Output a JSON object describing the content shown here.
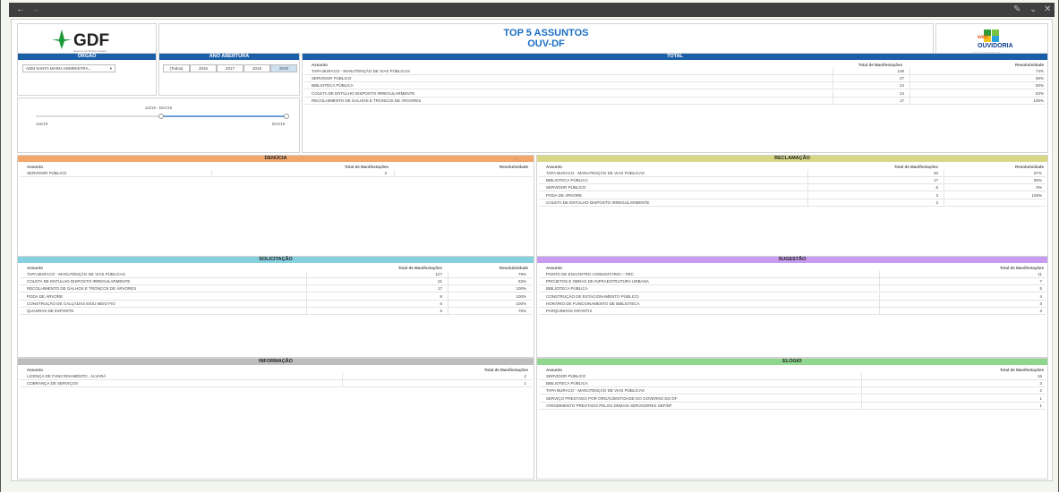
{
  "header": {
    "logo_left": "GDF",
    "logo_left_sub": "Governo do Distrito Federal",
    "title_line1": "TOP 5 ASSUNTOS",
    "title_line2": "OUV-DF",
    "logo_right": "OUVIDORIA",
    "logo_right_url": "www.ouvidoria.df.gov.br"
  },
  "filters": {
    "orgao_header": "ÓRGÃO",
    "orgao_value": "ADM SANTA MARIA ADMINISTRA...",
    "ano_header": "ANO ABERTURA",
    "ano_options": [
      "(Todos)",
      "2016",
      "2017",
      "2018",
      "2019"
    ],
    "ano_selected": "2019",
    "range_label": "Jul/19 - Dec/19",
    "range_min": "Jan/19",
    "range_max": "Dec/19",
    "range_fraction": [
      0.5,
      1.0
    ]
  },
  "colors": {
    "blue": "#1a5fa8",
    "denuncia": "#f3a66a",
    "reclamacao": "#d7d785",
    "solicitacao": "#86d1e0",
    "sugestao": "#c89bf0",
    "informacao": "#bdbdbd",
    "elogio": "#8fd68f"
  },
  "cols": {
    "assunto": "Assunto",
    "total": "Total de Manifestações",
    "resol": "Resolutividade"
  },
  "total": {
    "title": "TOTAL",
    "rows": [
      [
        "TAPA BURACO - MANUTENÇÃO DE VIAS PÚBLICAS",
        "149",
        "74%"
      ],
      [
        "SERVIDOR PÚBLICO",
        "27",
        "56%"
      ],
      [
        "BIBLIOTECA PÚBLICA",
        "24",
        "50%"
      ],
      [
        "COLETA DE ENTULHO DISPOSTO IRREGULARMENTE",
        "24",
        "83%"
      ],
      [
        "RECOLHIMENTO DE GALHOS E TRONCOS DE ÁRVORES",
        "17",
        "100%"
      ]
    ]
  },
  "denuncia": {
    "title": "DENÚCIA",
    "rows": [
      [
        "SERVIDOR PÚBLICO",
        "3",
        ""
      ]
    ]
  },
  "reclamacao": {
    "title": "RECLAMAÇÃO",
    "rows": [
      [
        "TAPA BURACO - MANUTENÇÃO DE VIAS PÚBLICAS",
        "20",
        "67%"
      ],
      [
        "BIBLIOTECA PÚBLICA",
        "17",
        "50%"
      ],
      [
        "SERVIDOR PÚBLICO",
        "6",
        "0%"
      ],
      [
        "PODA DE ÁRVORE",
        "3",
        "100%"
      ],
      [
        "COLETA DE ENTULHO DISPOSTO IRREGULARMENTE",
        "3",
        ""
      ]
    ]
  },
  "solicitacao": {
    "title": "SOLICITAÇÃO",
    "rows": [
      [
        "TAPA BURACO - MANUTENÇÃO DE VIAS PÚBLICAS",
        "127",
        "78%"
      ],
      [
        "COLETA DE ENTULHO DISPOSTO IRREGULARMENTE",
        "21",
        "83%"
      ],
      [
        "RECOLHIMENTO DE GALHOS E TRONCOS DE ÁRVORES",
        "17",
        "100%"
      ],
      [
        "PODA DE ÁRVORE",
        "8",
        "100%"
      ],
      [
        "CONSTRUÇÃO DE CALÇADAS E/OU MEIO FIO",
        "6",
        "100%"
      ],
      [
        "QUADRAS DE ESPORTE",
        "5",
        "75%"
      ]
    ]
  },
  "sugestao": {
    "title": "SUGESTÃO",
    "rows": [
      [
        "PONTO DE ENCONTRO COMUNITÁRIO – PEC",
        "11"
      ],
      [
        "PROJETOS E OBRAS DE INFRAESTRUTURA URBANA",
        "7"
      ],
      [
        "BIBLIOTECA PÚBLICA",
        "5"
      ],
      [
        "CONSTRUÇÃO DE ESTACIONAMENTO PÚBLICO",
        "4"
      ],
      [
        "HORÁRIO DE FUNCIONAMENTO DE BIBLIOTECA",
        "3"
      ],
      [
        "PARQUINHOS INFANTIS",
        "3"
      ]
    ]
  },
  "informacao": {
    "title": "INFORMAÇÃO",
    "rows": [
      [
        "LICENÇA DE FUNCIONAMENTO , ALVARÁ",
        "2"
      ],
      [
        "COBRANÇA DE SERVIÇOS",
        "1"
      ]
    ]
  },
  "elogio": {
    "title": "ELOGIO",
    "rows": [
      [
        "SERVIDOR PÚBLICO",
        "16"
      ],
      [
        "BIBLIOTECA PÚBLICA",
        "3"
      ],
      [
        "TAPA BURACO - MANUTENÇÃO DE VIAS PÚBLICAS",
        "2"
      ],
      [
        "SERVIÇO PRESTADO POR ÓRGÃO/ENTIDADE DO GOVERNO DO DF",
        "1"
      ],
      [
        "ATENDIMENTO PRESTADO PELOS DEMAIS SERVIDORES SEF/DF",
        "1"
      ]
    ]
  }
}
